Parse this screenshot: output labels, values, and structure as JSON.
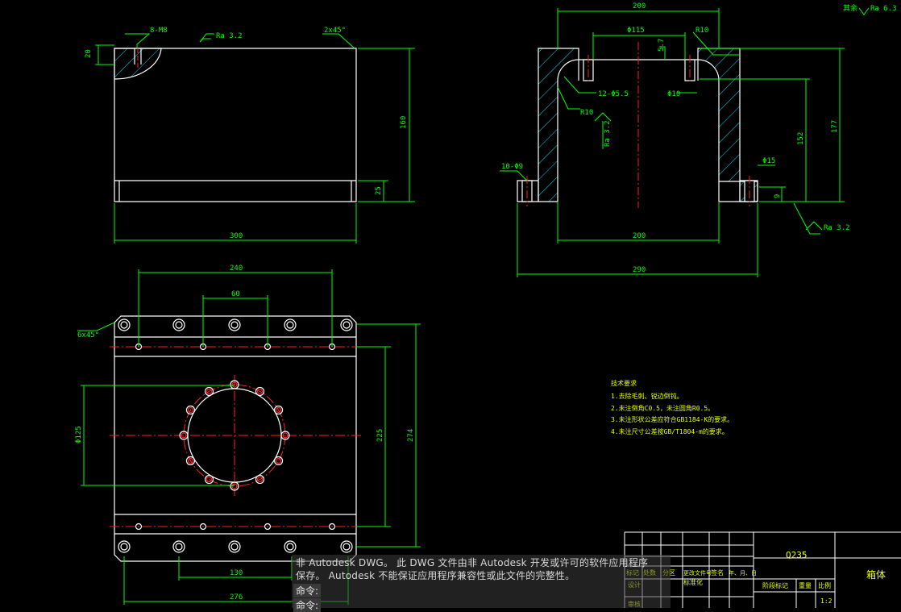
{
  "colors": {
    "outline": "#ffffff",
    "dimension": "#00ff00",
    "hatch": "#00e0ff",
    "center": "#ff2020",
    "note": "#e6ff00",
    "command_bg": "#3a3a3a"
  },
  "views": {
    "top_left": {
      "thread_note": "8-M8",
      "roughness": "Ra 3.2",
      "chamfer": "2x45°",
      "dim_side": "20",
      "dim_height": "160",
      "dim_base": "25",
      "dim_width": "300"
    },
    "section": {
      "dim_top": "200",
      "dim_bore": "Φ115",
      "fillet_top": "R10",
      "depth_small": "5.7",
      "holes_top": "12-Φ5.5",
      "dia_small": "Φ10",
      "fillet_inner": "R10",
      "roughness_side": "Ra 3.2",
      "holes_bottom": "10-Φ9",
      "dia_bottom": "Φ15",
      "dim_inner_height": "152",
      "dim_total_height": "177",
      "dim_bottom_small": "9",
      "dim_inner_width": "200",
      "dim_total_width": "290",
      "roughness_bottom": "Ra 3.2",
      "roughness_corner": "Ra 6.3",
      "remaining_label": "其余"
    },
    "plan": {
      "dim_holes_span": "240",
      "dim_pitch": "60",
      "chamfer": "6x45°",
      "dim_circle": "Φ125",
      "dim_inner": "225",
      "dim_outer": "274",
      "dim_bottom_small": "130",
      "dim_bottom_total": "276"
    }
  },
  "notes": {
    "title": "技术要求",
    "items": [
      "1.去除毛刺、锐边倒钝。",
      "2.未注倒角C0.5，未注圆角R0.5。",
      "3.未注形状公差应符合GB1184-K的要求。",
      "4.未注尺寸公差按GB/T1804-m的要求。"
    ]
  },
  "title_block": {
    "material": "Q235",
    "part_name": "箱体",
    "scale_label": "比例",
    "scale_value": "1:2",
    "weight_label": "重量",
    "stage_label": "阶段标记",
    "header_cells": [
      "标记",
      "处数",
      "分区",
      "更改文件号",
      "签名",
      "年、月、日"
    ],
    "row_labels": [
      "设计",
      "标准化",
      "审核"
    ]
  },
  "command": {
    "message_line1": "非 Autodesk DWG。 此 DWG 文件由非 Autodesk 开发或许可的软件应用程序",
    "message_line2": "保存。 Autodesk 不能保证应用程序兼容性或此文件的完整性。",
    "prompt1": "命令:",
    "prompt2": "命令:"
  }
}
